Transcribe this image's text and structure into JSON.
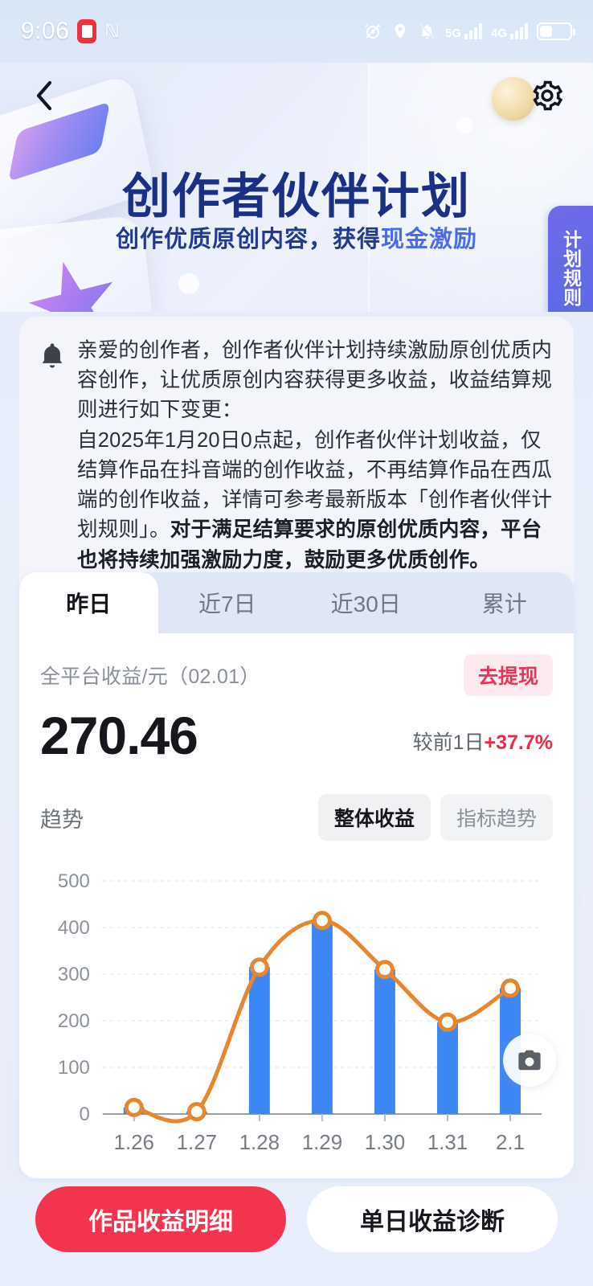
{
  "statusbar": {
    "time": "9:06",
    "app_badge_icon": "app-badge-icon",
    "nfc_icon": "nfc-icon",
    "alarm_icon": "alarm-icon",
    "location_icon": "location-icon",
    "mute_icon": "mute-bell-icon",
    "network_primary": "5G",
    "network_secondary": "4G",
    "battery_icon": "battery-icon"
  },
  "banner": {
    "back_icon": "back-chevron-icon",
    "settings_icon": "gear-icon",
    "title": "创作者伙伴计划",
    "subtitle_plain": "创作优质原创内容，获得",
    "subtitle_highlight": "现金激励",
    "rules_tab": "计划规则"
  },
  "notice": {
    "icon": "bell-icon",
    "paragraph1": "亲爱的创作者，创作者伙伴计划持续激励原创优质内容创作，让优质原创内容获得更多收益，收益结算规则进行如下变更：",
    "paragraph2_normal": "自2025年1月20日0点起，创作者伙伴计划收益，仅结算作品在抖音端的创作收益，不再结算作品在西瓜端的创作收益，详情可参考最新版本「创作者伙伴计划规则」。",
    "paragraph2_strong": "对于满足结算要求的原创优质内容，平台也将持续加强激励力度，鼓励更多优质创作。"
  },
  "datacard": {
    "tabs": [
      {
        "label": "昨日",
        "active": true
      },
      {
        "label": "近7日",
        "active": false
      },
      {
        "label": "近30日",
        "active": false
      },
      {
        "label": "累计",
        "active": false
      }
    ],
    "earnings_label": "全平台收益/元（02.01）",
    "withdraw_button": "去提现",
    "amount": "270.46",
    "delta_prefix": "较前1日",
    "delta_value": "+37.7%",
    "trend_label": "趋势",
    "segments": [
      {
        "label": "整体收益",
        "active": true
      },
      {
        "label": "指标趋势",
        "active": false
      }
    ],
    "camera_icon": "camera-icon"
  },
  "bottom": {
    "primary_button": "作品收益明细",
    "secondary_button": "单日收益诊断"
  },
  "colors": {
    "accent_red": "#f3344f",
    "bar_blue": "#3d87f5",
    "line_orange": "#e8862f",
    "brand_navy": "#1b2f86",
    "rules_purple": "#5f67e7",
    "page_bg": "#e8eefb"
  },
  "chart_data": {
    "type": "bar",
    "title": "",
    "xlabel": "",
    "ylabel": "",
    "categories": [
      "1.26",
      "1.27",
      "1.28",
      "1.29",
      "1.30",
      "1.31",
      "2.1"
    ],
    "yticks": [
      0,
      100,
      200,
      300,
      400,
      500
    ],
    "ylim": [
      0,
      500
    ],
    "grid": true,
    "legend": "none",
    "series": [
      {
        "name": "整体收益",
        "type": "bar",
        "values": [
          14,
          5,
          315,
          415,
          310,
          197,
          270
        ]
      },
      {
        "name": "趋势线",
        "type": "line",
        "values": [
          14,
          5,
          315,
          415,
          310,
          197,
          270
        ]
      }
    ]
  }
}
